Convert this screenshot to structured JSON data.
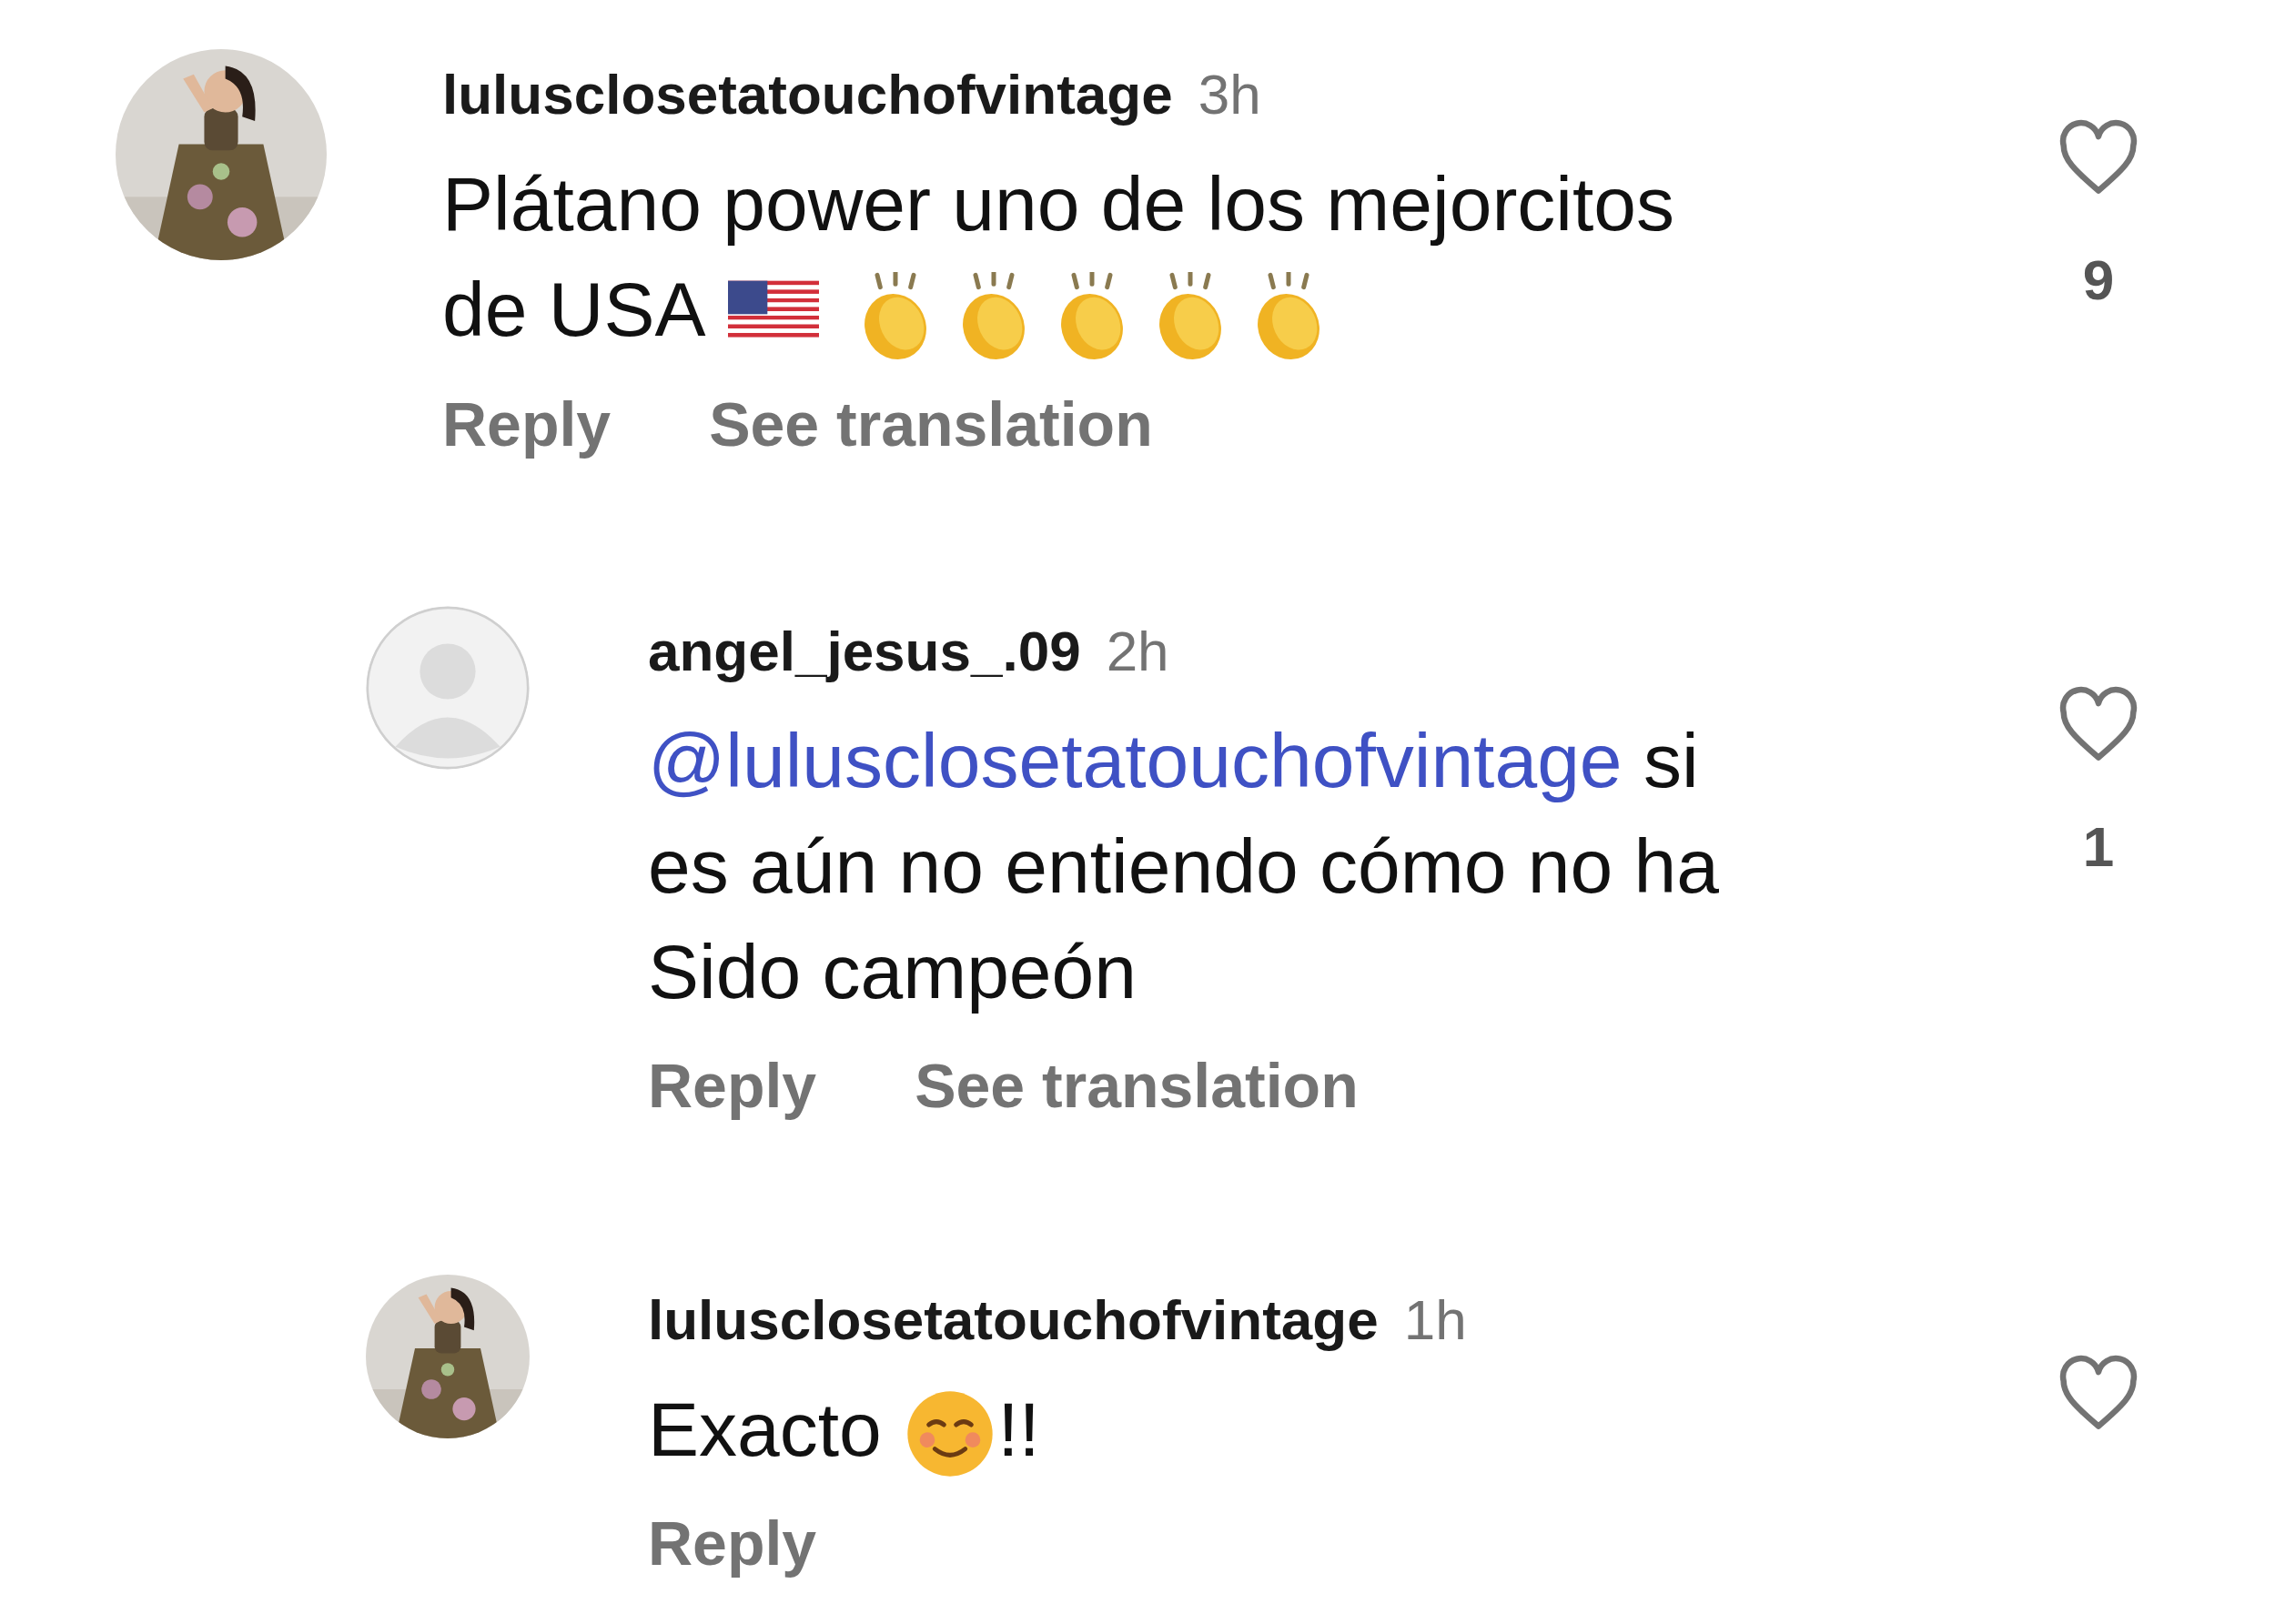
{
  "comments": [
    {
      "username": "lulusclosetatouchofvintage",
      "time": "3h",
      "avatar": {
        "kind": "picture"
      },
      "body": [
        {
          "kind": "text",
          "text": "Plátano power uno de los mejorcitos de USA "
        },
        {
          "kind": "flag"
        },
        {
          "kind": "clap"
        },
        {
          "kind": "clap"
        },
        {
          "kind": "clap"
        },
        {
          "kind": "clap"
        },
        {
          "kind": "clap"
        }
      ],
      "actions": [
        "Reply",
        "See translation"
      ],
      "liked": false,
      "likes": "9",
      "children": [
        {
          "username": "angel_jesus_.09",
          "time": "2h",
          "avatar": {
            "kind": "default"
          },
          "body": [
            {
              "kind": "mention",
              "text": "@lulusclosetatouchofvintage"
            },
            {
              "kind": "text",
              "text": " si es aún no entiendo cómo no ha Sido campeón"
            }
          ],
          "actions": [
            "Reply",
            "See translation"
          ],
          "liked": false,
          "likes": "1"
        },
        {
          "username": "lulusclosetatouchofvintage",
          "time": "1h",
          "avatar": {
            "kind": "picture"
          },
          "body": [
            {
              "kind": "text",
              "text": "Exacto "
            },
            {
              "kind": "smile"
            },
            {
              "kind": "text",
              "text": "!!"
            }
          ],
          "actions": [
            "Reply"
          ],
          "liked": false
        }
      ]
    }
  ]
}
